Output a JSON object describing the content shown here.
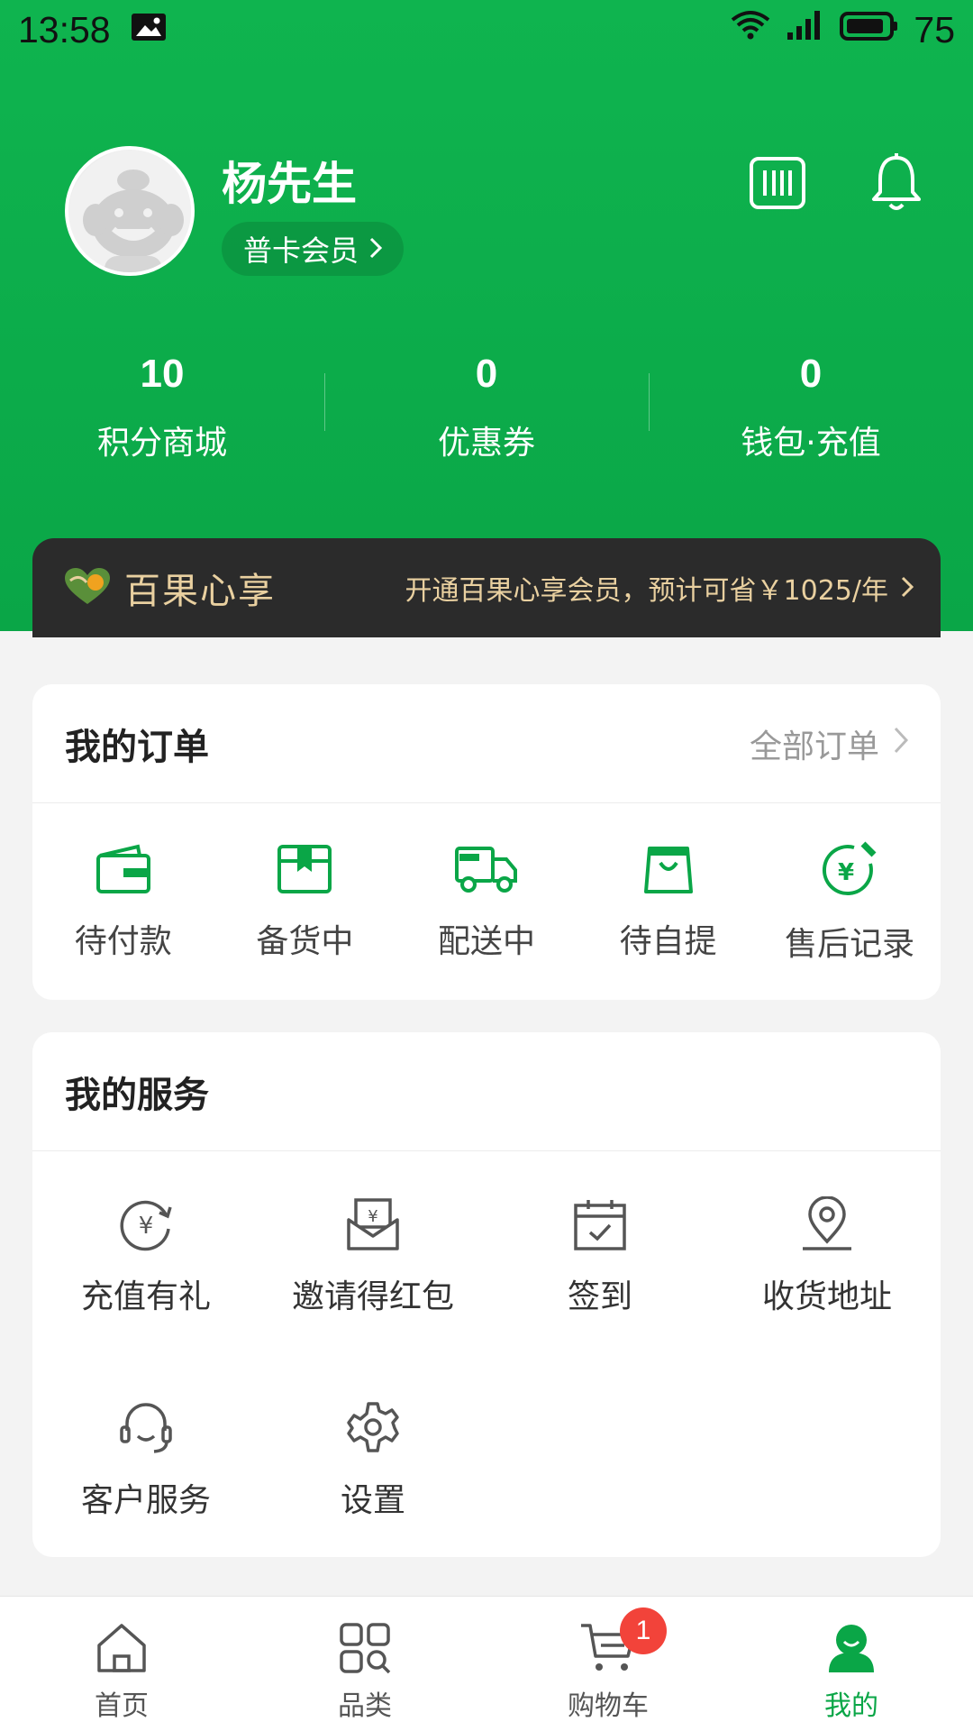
{
  "status_bar": {
    "time": "13:58",
    "battery": "75"
  },
  "profile": {
    "name": "杨先生",
    "member_level": "普卡会员"
  },
  "stats": [
    {
      "value": "10",
      "label": "积分商城"
    },
    {
      "value": "0",
      "label": "优惠券"
    },
    {
      "value": "0",
      "label": "钱包·充值"
    }
  ],
  "vip": {
    "brand": "百果心享",
    "desc": "开通百果心享会员，预计可省￥1025/年"
  },
  "orders": {
    "title": "我的订单",
    "all_label": "全部订单",
    "items": [
      {
        "label": "待付款",
        "icon": "wallet-icon"
      },
      {
        "label": "备货中",
        "icon": "package-icon"
      },
      {
        "label": "配送中",
        "icon": "truck-icon"
      },
      {
        "label": "待自提",
        "icon": "shopping-bag-icon"
      },
      {
        "label": "售后记录",
        "icon": "refund-icon"
      }
    ]
  },
  "services": {
    "title": "我的服务",
    "items": [
      {
        "label": "充值有礼",
        "icon": "recharge-icon"
      },
      {
        "label": "邀请得红包",
        "icon": "envelope-icon"
      },
      {
        "label": "签到",
        "icon": "calendar-check-icon"
      },
      {
        "label": "收货地址",
        "icon": "location-pin-icon"
      },
      {
        "label": "客户服务",
        "icon": "headset-icon"
      },
      {
        "label": "设置",
        "icon": "gear-icon"
      }
    ]
  },
  "tabbar": {
    "items": [
      {
        "label": "首页",
        "icon": "home-icon"
      },
      {
        "label": "品类",
        "icon": "category-icon"
      },
      {
        "label": "购物车",
        "icon": "cart-icon",
        "badge": "1"
      },
      {
        "label": "我的",
        "icon": "profile-icon",
        "active": true
      }
    ]
  },
  "colors": {
    "brand_green": "#0aa647",
    "vip_gold": "#e9d0a0",
    "badge_red": "#f2433a"
  }
}
